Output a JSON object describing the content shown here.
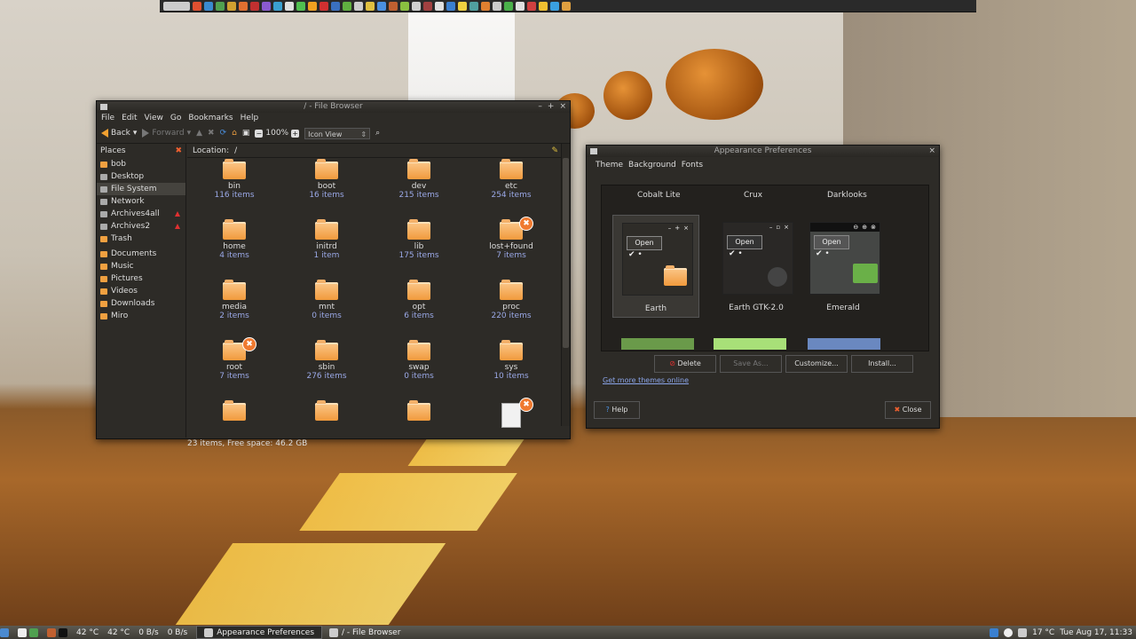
{
  "desktop": {
    "wall_color": "#c9c1b3",
    "floor_color": "#a8682a"
  },
  "top_panel": {
    "clock": "Tue Aug 17, 11:33"
  },
  "file_browser": {
    "title": "/ - File Browser",
    "menu": [
      "File",
      "Edit",
      "View",
      "Go",
      "Bookmarks",
      "Help"
    ],
    "toolbar": {
      "back": "Back",
      "forward": "Forward",
      "zoom": "100%",
      "view_mode": "Icon View"
    },
    "places_label": "Places",
    "location_label": "Location:",
    "location_value": "/",
    "places": [
      {
        "label": "bob",
        "icon": "home-folder-icon"
      },
      {
        "label": "Desktop",
        "icon": "desktop-icon"
      },
      {
        "label": "File System",
        "icon": "drive-icon",
        "selected": true
      },
      {
        "label": "Network",
        "icon": "network-icon"
      },
      {
        "label": "Archives4all",
        "icon": "drive-icon",
        "eject": true
      },
      {
        "label": "Archives2",
        "icon": "drive-icon",
        "eject": true
      },
      {
        "label": "Trash",
        "icon": "trash-icon"
      },
      {
        "label": "Documents",
        "icon": "folder-icon"
      },
      {
        "label": "Music",
        "icon": "folder-icon"
      },
      {
        "label": "Pictures",
        "icon": "folder-icon"
      },
      {
        "label": "Videos",
        "icon": "folder-icon"
      },
      {
        "label": "Downloads",
        "icon": "folder-icon"
      },
      {
        "label": "Miro",
        "icon": "folder-icon"
      }
    ],
    "files": [
      {
        "name": "bin",
        "count": "116 items"
      },
      {
        "name": "boot",
        "count": "16 items"
      },
      {
        "name": "dev",
        "count": "215 items"
      },
      {
        "name": "etc",
        "count": "254 items"
      },
      {
        "name": "home",
        "count": "4 items"
      },
      {
        "name": "initrd",
        "count": "1 item"
      },
      {
        "name": "lib",
        "count": "175 items"
      },
      {
        "name": "lost+found",
        "count": "7 items",
        "locked": true
      },
      {
        "name": "media",
        "count": "2 items"
      },
      {
        "name": "mnt",
        "count": "0 items"
      },
      {
        "name": "opt",
        "count": "6 items"
      },
      {
        "name": "proc",
        "count": "220 items"
      },
      {
        "name": "root",
        "count": "7 items",
        "locked": true
      },
      {
        "name": "sbin",
        "count": "276 items"
      },
      {
        "name": "swap",
        "count": "0 items"
      },
      {
        "name": "sys",
        "count": "10 items"
      },
      {
        "name": "",
        "count": ""
      },
      {
        "name": "",
        "count": ""
      },
      {
        "name": "",
        "count": ""
      },
      {
        "name": "",
        "count": "",
        "doc": true,
        "locked": true
      }
    ],
    "status": "23 items, Free space: 46.2 GB"
  },
  "appearance": {
    "title": "Appearance Preferences",
    "tabs": [
      "Theme",
      "Background",
      "Fonts"
    ],
    "headers": [
      "Cobalt Lite",
      "Crux",
      "Darklooks"
    ],
    "themes": [
      {
        "name": "Earth",
        "open_label": "Open"
      },
      {
        "name": "Earth GTK-2.0",
        "open_label": "Open"
      },
      {
        "name": "Emerald",
        "open_label": "Open"
      }
    ],
    "buttons": {
      "delete": "Delete",
      "save_as": "Save As...",
      "customize": "Customize...",
      "install": "Install..."
    },
    "link": "Get more themes online",
    "help": "Help",
    "close": "Close"
  },
  "bottom_panel": {
    "temp1": "42 °C",
    "temp2": "42 °C",
    "net1": "0 B/s",
    "net2": "0 B/s",
    "tasks": [
      "Appearance Preferences",
      "/ - File Browser"
    ],
    "weather": "17 °C",
    "clock": "Tue Aug 17, 11:33"
  }
}
